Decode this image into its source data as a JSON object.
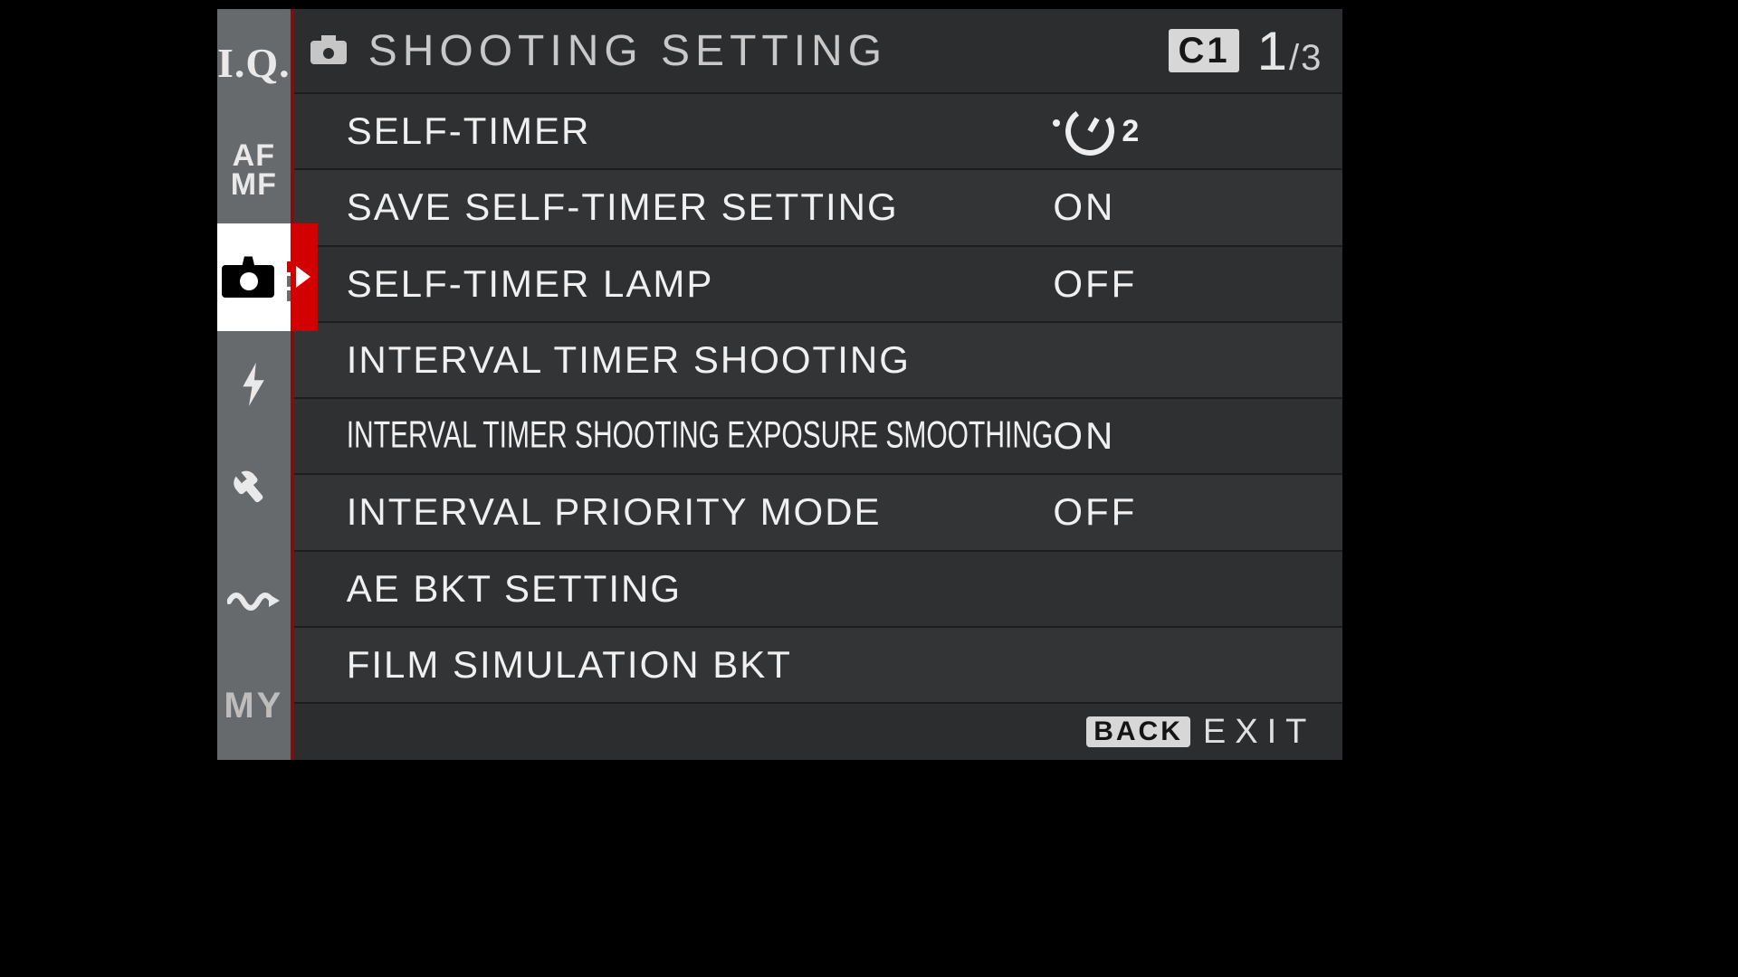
{
  "sidebar": {
    "tabs": [
      {
        "id": "iq",
        "label": "I.Q."
      },
      {
        "id": "afmf",
        "label_top": "AF",
        "label_bottom": "MF"
      },
      {
        "id": "shoot",
        "selected": true
      },
      {
        "id": "flash"
      },
      {
        "id": "setup"
      },
      {
        "id": "movie"
      },
      {
        "id": "my",
        "label": "MY"
      }
    ]
  },
  "header": {
    "title": "SHOOTING SETTING",
    "custom_bank": "C1",
    "page_current": "1",
    "page_sep": "/",
    "page_total": "3"
  },
  "rows": [
    {
      "label": "SELF-TIMER",
      "value_type": "selftimer",
      "value_num": "2"
    },
    {
      "label": "SAVE SELF-TIMER SETTING",
      "value": "ON"
    },
    {
      "label": "SELF-TIMER LAMP",
      "value": "OFF"
    },
    {
      "label": "INTERVAL TIMER SHOOTING",
      "value": ""
    },
    {
      "label": "INTERVAL TIMER SHOOTING EXPOSURE SMOOTHING",
      "value": "ON",
      "compressed": true
    },
    {
      "label": "INTERVAL PRIORITY MODE",
      "value": "OFF"
    },
    {
      "label": "AE BKT SETTING",
      "value": ""
    },
    {
      "label": "FILM SIMULATION BKT",
      "value": ""
    }
  ],
  "footer": {
    "back_label": "BACK",
    "exit_label": "EXIT"
  }
}
